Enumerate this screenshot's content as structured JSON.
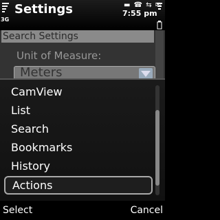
{
  "status": {
    "title": "Settings",
    "network": "3G",
    "clock": "7:55 pm",
    "status_icons": "▬ ☎ ⇆ ✉"
  },
  "background": {
    "search_text": "Search Settings",
    "unit_label": "Unit of Measure:",
    "unit_value": "Meters"
  },
  "menu": {
    "items": [
      "CamView",
      "List",
      "Search",
      "Bookmarks",
      "History",
      "Actions"
    ],
    "selected_index": 5
  },
  "softkeys": {
    "left": "Select",
    "right": "Cancel"
  }
}
